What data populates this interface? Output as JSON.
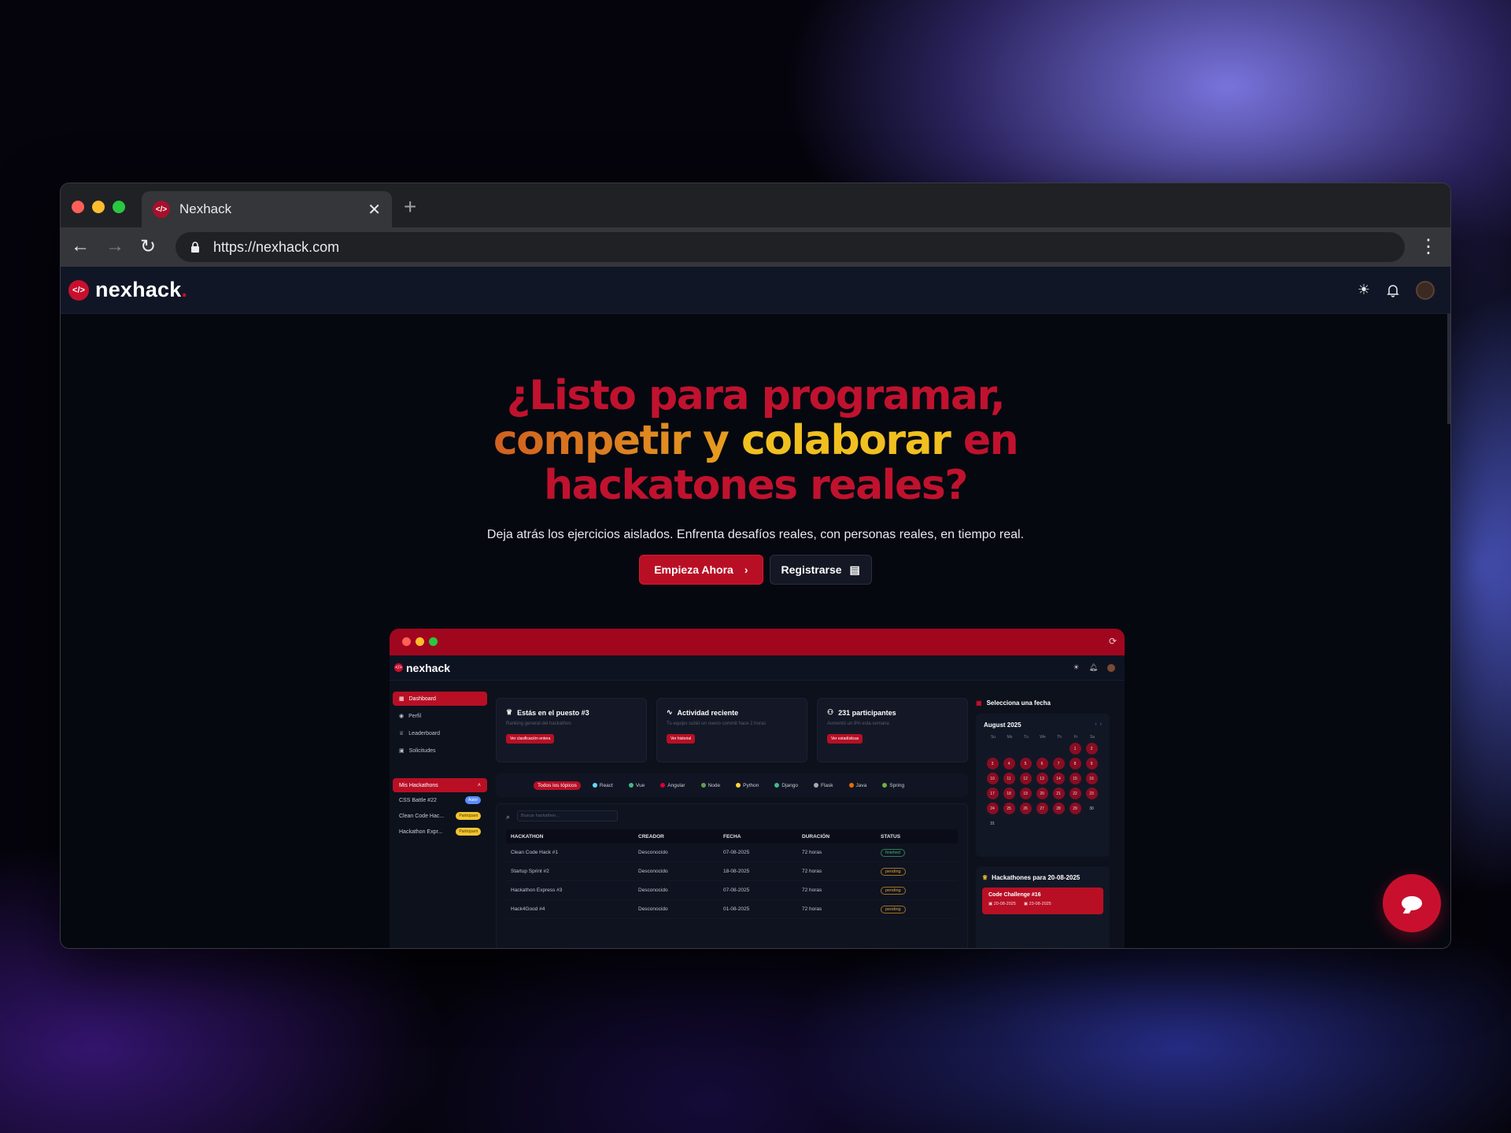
{
  "browser": {
    "tab_title": "Nexhack",
    "url": "https://nexhack.com",
    "dots": [
      "#ff5f57",
      "#febc2e",
      "#28c840"
    ]
  },
  "site": {
    "logo": "nexhack",
    "logo_dot": ".",
    "header_icons": [
      "sun-icon",
      "bell-icon",
      "avatar"
    ]
  },
  "hero": {
    "line1": "¿Listo para programar,",
    "line2_a": "competir y ",
    "line2_b": "colaborar",
    "line2_c": " en",
    "line3": "hackatones reales?",
    "subtitle": "Deja atrás los ejercicios aislados. Enfrenta desafíos reales, con personas reales, en tiempo real.",
    "cta_primary": "Empieza Ahora",
    "cta_secondary": "Registrarse"
  },
  "mock": {
    "logo": "nexhack",
    "sidebar": [
      "Dashboard",
      "Perfil",
      "Leaderboard",
      "Solicitudes"
    ],
    "my_hackathons_label": "Mis Hackathons",
    "my_hackathons": [
      {
        "name": "CSS Battle #22",
        "badge": "Autor",
        "badge_color": "#5b8cff"
      },
      {
        "name": "Clean Code Hac...",
        "badge": "Participant",
        "badge_color": "#f2c530"
      },
      {
        "name": "Hackathon Expr...",
        "badge": "Participant",
        "badge_color": "#f2c530"
      }
    ],
    "cards": [
      {
        "title": "Estás en el puesto #3",
        "sub": "Ranking general del hackathon",
        "btn": "Ver clasificación entera"
      },
      {
        "title": "Actividad reciente",
        "sub": "Tu equipo subió un nuevo commit hace 2 horas",
        "btn": "Ver historial"
      },
      {
        "title": "231 participantes",
        "sub": "Aumentó un 8% esta semana",
        "btn": "Ver estadísticas"
      }
    ],
    "topics": [
      "Todos los tópicos",
      "React",
      "Vue",
      "Angular",
      "Node",
      "Python",
      "Django",
      "Flask",
      "Java",
      "Spring"
    ],
    "search_placeholder": "Buscar hackathon...",
    "table_headers": [
      "HACKATHON",
      "CREADOR",
      "FECHA",
      "DURACIÓN",
      "STATUS"
    ],
    "table_rows": [
      [
        "Clean Code Hack #1",
        "Desconocido",
        "07-08-2025",
        "72 horas",
        "finished"
      ],
      [
        "Startup Sprint #2",
        "Desconocido",
        "18-08-2025",
        "72 horas",
        "pending"
      ],
      [
        "Hackathon Express #3",
        "Desconocido",
        "07-08-2025",
        "72 horas",
        "pending"
      ],
      [
        "Hack4Good #4",
        "Desconocido",
        "01-08-2025",
        "72 horas",
        "pending"
      ]
    ],
    "calendar_title": "Selecciona una fecha",
    "calendar_month": "August 2025",
    "calendar_dow": [
      "Su",
      "Mo",
      "Tu",
      "We",
      "Th",
      "Fr",
      "Sa"
    ],
    "events_title": "Hackathones para 20-08-2025",
    "event_name": "Code Challenge #16",
    "event_start": "20-08-2025",
    "event_end": "23-08-2025"
  }
}
